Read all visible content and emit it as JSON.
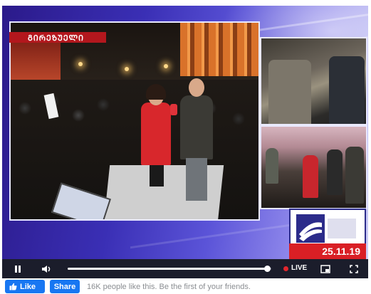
{
  "video": {
    "station_label": "ᲒᲘᲠᲔᲖᲣᲔᲚᲘ",
    "broadcast_date": "25.11.19"
  },
  "player": {
    "live_label": "LIVE",
    "progress_fraction": 0.98,
    "icons": {
      "play": "pause-icon",
      "volume": "volume-icon",
      "pip": "picture-in-picture-icon",
      "fullscreen": "fullscreen-icon"
    }
  },
  "facebook": {
    "like_label": "Like",
    "share_label": "Share",
    "social_text": "16K people like this. Be the first of your friends."
  },
  "colors": {
    "accent_red": "#d91f25",
    "control_bar": "#1b1d2b",
    "facebook_blue": "#1877f2"
  }
}
